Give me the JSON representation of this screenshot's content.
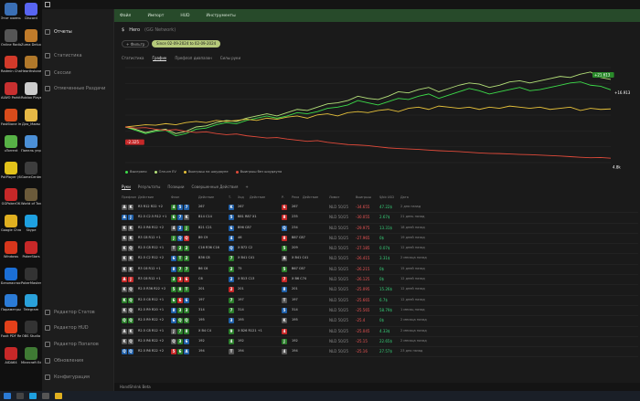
{
  "desktop_icons": [
    {
      "label": "Этот компьютер",
      "color": "#3a6fb5"
    },
    {
      "label": "Discord",
      "color": "#5865f2"
    },
    {
      "label": "Online Radio",
      "color": "#555"
    },
    {
      "label": "Zuma Deluxe",
      "color": "#c07b2a"
    },
    {
      "label": "Radmin Chat",
      "color": "#d23a2a"
    },
    {
      "label": "Hearthstone",
      "color": "#b0782a"
    },
    {
      "label": "ALWO Parkits",
      "color": "#c83030"
    },
    {
      "label": "Roblox Player",
      "color": "#cccccc"
    },
    {
      "label": "FastStone Image Viewer",
      "color": "#d84b1b"
    },
    {
      "label": "Для_Мамы",
      "color": "#e6b845"
    },
    {
      "label": "uTorrent",
      "color": "#57b246"
    },
    {
      "label": "Панель управления",
      "color": "#4b8fd6"
    },
    {
      "label": "PotPlayer (64-bit)",
      "color": "#e2c21a"
    },
    {
      "label": "GameCenter",
      "color": "#3d3d3d"
    },
    {
      "label": "GGPokerOK",
      "color": "#c62828"
    },
    {
      "label": "World of Tanks EU",
      "color": "#6b5a3a"
    },
    {
      "label": "Google Chrome",
      "color": "#e0b020"
    },
    {
      "label": "Skype",
      "color": "#1ea0e0"
    },
    {
      "label": "Windows",
      "color": "#d7361c"
    },
    {
      "label": "PokerStars",
      "color": "#c62828"
    },
    {
      "label": "Безопасность Windows",
      "color": "#1b6fd6"
    },
    {
      "label": "PokerMaster",
      "color": "#333"
    },
    {
      "label": "Параметры",
      "color": "#2b7bd6"
    },
    {
      "label": "Telegram",
      "color": "#2aa1da"
    },
    {
      "label": "Foxit PDF Reader",
      "color": "#e2401a"
    },
    {
      "label": "OBS Studio",
      "color": "#333"
    },
    {
      "label": "AIDA64",
      "color": "#c62828"
    },
    {
      "label": "Minecraft Education",
      "color": "#3f7a34"
    }
  ],
  "sidebar": {
    "items": [
      {
        "label": "Отчеты",
        "active": true
      },
      {
        "label": "Статистика",
        "active": false
      },
      {
        "label": "Сессии",
        "active": false
      },
      {
        "label": "Отмеченные Раздачи",
        "active": false
      }
    ],
    "bottom_items": [
      {
        "label": "Редактор Статов"
      },
      {
        "label": "Редактор HUD"
      },
      {
        "label": "Редактор Попапов"
      },
      {
        "label": "Обновления"
      },
      {
        "label": "Конфигурация"
      }
    ]
  },
  "menubar": {
    "items": [
      "Файл",
      "Импорт",
      "HUD",
      "Инструменты"
    ]
  },
  "header": {
    "title": "Hero",
    "subtitle": "(GG Network)"
  },
  "filter_button": "+ Фильтр",
  "date_range": "Since 02-09-2024 to 02-09-2024",
  "chart_tabs": [
    "Статистика",
    "График",
    "Префлоп диапазон",
    "Силы руки"
  ],
  "active_chart_tab": "График",
  "chart_data": {
    "type": "line",
    "x": [
      0,
      100,
      200,
      300,
      400,
      500,
      600,
      700,
      800,
      900,
      1000,
      1100,
      1200,
      1300,
      1400,
      1500,
      1600,
      1700,
      1800,
      1900,
      2000,
      2100,
      2200,
      2300,
      2400,
      2500,
      2600,
      2700,
      2800,
      2900,
      3000,
      3100,
      3200,
      3300,
      3400,
      3500,
      3600,
      3700,
      3800,
      3900,
      4000,
      4100,
      4200,
      4300,
      4400,
      4500,
      4600,
      4700,
      4800
    ],
    "series": [
      {
        "name": "Выиграно",
        "color": "#3ddc4a",
        "values": [
          0,
          -1.5,
          -3,
          -2,
          -1.5,
          -4,
          -3,
          -1,
          -0.5,
          1,
          2,
          1.5,
          3,
          4,
          5,
          4,
          5,
          6.5,
          6,
          7,
          8.5,
          9,
          10,
          12,
          11,
          10,
          11.5,
          13,
          12.5,
          14,
          15,
          13,
          14.5,
          16,
          17.5,
          16.5,
          15,
          16,
          17,
          18,
          16.5,
          17,
          18,
          19,
          20,
          20.5,
          19,
          18.5,
          16.913
        ]
      },
      {
        "name": "Олл-ин EV",
        "color": "#b5e27a",
        "values": [
          0,
          -1,
          -2.5,
          -1.5,
          -1,
          -3,
          -2,
          0,
          0.5,
          2,
          3,
          2.5,
          4,
          5,
          6,
          5,
          6.5,
          8,
          7.5,
          9,
          10.5,
          11,
          12,
          14,
          13,
          12.5,
          14,
          16,
          15.5,
          17,
          18,
          16,
          17.5,
          19,
          20,
          19.5,
          18,
          19,
          20.5,
          21,
          20,
          21,
          22,
          23,
          22.5,
          24,
          25,
          22.5,
          21.613
        ]
      },
      {
        "name": "Выигрыш на шоудауне",
        "color": "#e7c23a",
        "values": [
          0,
          0.5,
          1,
          0.8,
          1.5,
          1,
          2,
          2.5,
          2,
          3,
          2.5,
          3,
          3.5,
          3,
          4,
          3.5,
          4.5,
          5,
          4,
          5.5,
          6,
          5,
          6.5,
          7,
          6.5,
          7.5,
          8,
          7,
          8.5,
          9,
          8,
          9.5,
          9,
          8.5,
          9,
          8,
          9,
          8.5,
          9.5,
          9,
          8.5,
          9,
          8,
          8.5,
          9,
          7.5,
          8.5,
          8,
          8.2
        ]
      },
      {
        "name": "Выигрыш без шоудауна",
        "color": "#e04a3a",
        "values": [
          0,
          -0.5,
          -0.3,
          -1,
          -1.5,
          -1.2,
          -2,
          -2.5,
          -2.2,
          -3,
          -3.5,
          -3.2,
          -4,
          -4.5,
          -5,
          -4.8,
          -5.5,
          -6,
          -6.5,
          -6.2,
          -7,
          -7.5,
          -8,
          -8.2,
          -8.5,
          -9,
          -9.5,
          -9.8,
          -10,
          -10.2,
          -10.5,
          -10.8,
          -11,
          -11.2,
          -11.5,
          -11.8,
          -12,
          -12.1,
          -12.3,
          -12.5,
          -12.6,
          -12.8,
          -13,
          -13.2,
          -13.5,
          -13.8,
          -14,
          -13.9,
          -14.2
        ]
      }
    ],
    "labels": {
      "final_allin": "+21.613",
      "final_won": "+16.913",
      "min": "-2.325",
      "max_x": "4.8k"
    },
    "grid": true
  },
  "table_tabs": [
    "Руки",
    "Результаты",
    "Позиции",
    "Совершенные Действия",
    "+"
  ],
  "table_headers": [
    "Префлоп",
    "Действие",
    "Флоп",
    "Действие",
    "Т.",
    "Ход",
    "Действие",
    "Р.",
    "Река",
    "Действие",
    "Лимит",
    "Выигрыш",
    "$/bb USD",
    "Дата"
  ],
  "rows": [
    {
      "hand": [
        "A",
        "K"
      ],
      "hc": [
        "#555",
        "#555"
      ],
      "pre": "R3 R12 R22 +2",
      "flop": [
        "4",
        "5",
        "7"
      ],
      "fc": [
        "#2a7d2a",
        "#1f5fa8",
        "#1f5fa8"
      ],
      "fa": "267",
      "turn": "K",
      "tc": "#1f5fa8",
      "ta": "267",
      "river": "6",
      "rc": "#c62828",
      "ra": "267",
      "limit": "NLD 50/25",
      "won": "-34.655",
      "bb": "47.22$",
      "date": "2 дня назад"
    },
    {
      "hand": [
        "A",
        "J"
      ],
      "hc": [
        "#1f5fa8",
        "#1f5fa8"
      ],
      "pre": "R2.5 C2.5 R12 +1",
      "flop": [
        "6",
        "7",
        "K"
      ],
      "fc": [
        "#2a7d2a",
        "#1f5fa8",
        "#555"
      ],
      "fa": "B14 C14",
      "turn": "5",
      "tc": "#1f5fa8",
      "ta": "B81 R87 X1",
      "river": "8",
      "rc": "#c62828",
      "ra": "235",
      "limit": "NLD 50/25",
      "won": "-30.055",
      "bb": "2.67$",
      "date": "21 день назад"
    },
    {
      "hand": [
        "K",
        "K"
      ],
      "hc": [
        "#555",
        "#555"
      ],
      "pre": "R2.5 R6 R12 +2",
      "flop": [
        "4",
        "2",
        "J"
      ],
      "fc": [
        "#555",
        "#1f5fa8",
        "#2a7d2a"
      ],
      "fa": "B21 C21",
      "turn": "6",
      "tc": "#1f5fa8",
      "ta": "B96 C87",
      "river": "Q",
      "rc": "#1f5fa8",
      "ra": "234",
      "limit": "NLD 50/25",
      "won": "-29.975",
      "bb": "13.31$",
      "date": "18 дней назад"
    },
    {
      "hand": [
        "K",
        "K"
      ],
      "hc": [
        "#555",
        "#555"
      ],
      "pre": "R3 C8 R12 +1",
      "flop": [
        "J",
        "Q",
        "Q"
      ],
      "fc": [
        "#2a7d2a",
        "#1f5fa8",
        "#c62828"
      ],
      "fa": "B9 C9",
      "turn": "4",
      "tc": "#1f5fa8",
      "ta": "46",
      "river": "8",
      "rc": "#c62828",
      "ra": "B87 C87",
      "limit": "NLD 50/25",
      "won": "-27.965",
      "bb": "0$",
      "date": "19 дней назад"
    },
    {
      "hand": [
        "K",
        "Q"
      ],
      "hc": [
        "#555",
        "#555"
      ],
      "pre": "R2.5 C8 R12 +1",
      "flop": [
        "T",
        "2",
        "2"
      ],
      "fc": [
        "#555",
        "#2a7d2a",
        "#2a7d2a"
      ],
      "fa": "C16 R36 C16",
      "turn": "Q",
      "tc": "#1f5fa8",
      "ta": "X B72 C2",
      "river": "5",
      "rc": "#2a7d2a",
      "ra": "209",
      "limit": "NLD 50/25",
      "won": "-27.185",
      "bb": "0.07$",
      "date": "12 дней назад"
    },
    {
      "hand": [
        "K",
        "K"
      ],
      "hc": [
        "#555",
        "#555"
      ],
      "pre": "R2.5 C2 R12 +2",
      "flop": [
        "6",
        "T",
        "2"
      ],
      "fc": [
        "#1f5fa8",
        "#2a7d2a",
        "#2a7d2a"
      ],
      "fa": "B36 C8",
      "turn": "7",
      "tc": "#2a7d2a",
      "ta": "X B41 C41",
      "river": "A",
      "rc": "#555",
      "ra": "X B41 C41",
      "limit": "NLD 50/25",
      "won": "-26.415",
      "bb": "3.31$",
      "date": "2 месяца назад"
    },
    {
      "hand": [
        "K",
        "K"
      ],
      "hc": [
        "#555",
        "#555"
      ],
      "pre": "R3 C6 R12 +1",
      "flop": [
        "8",
        "7",
        "7"
      ],
      "fc": [
        "#1f5fa8",
        "#2a7d2a",
        "#2a7d2a"
      ],
      "fa": "B6 C6",
      "turn": "2",
      "tc": "#2a7d2a",
      "ta": "75",
      "river": "5",
      "rc": "#2a7d2a",
      "ra": "B67 C67",
      "limit": "NLD 50/25",
      "won": "-26.215",
      "bb": "0$",
      "date": "15 дней назад"
    },
    {
      "hand": [
        "A",
        "J"
      ],
      "hc": [
        "#c62828",
        "#c62828"
      ],
      "pre": "R3 C6 R12 +1",
      "flop": [
        "3",
        "3",
        "6"
      ],
      "fc": [
        "#2a7d2a",
        "#c62828",
        "#c62828"
      ],
      "fa": "C6",
      "turn": "2",
      "tc": "#1f5fa8",
      "ta": "X B13 C13",
      "river": "7",
      "rc": "#c62828",
      "ra": "X B6 C74",
      "limit": "NLD 50/25",
      "won": "-26.125",
      "bb": "0$",
      "date": "12 дней назад"
    },
    {
      "hand": [
        "K",
        "Q"
      ],
      "hc": [
        "#555",
        "#555"
      ],
      "pre": "R2.5 R36 R22 +2",
      "flop": [
        "5",
        "8",
        "T"
      ],
      "fc": [
        "#2a7d2a",
        "#2a7d2a",
        "#2a7d2a"
      ],
      "fa": "201",
      "turn": "2",
      "tc": "#c62828",
      "ta": "201",
      "river": "8",
      "rc": "#1f5fa8",
      "ra": "201",
      "limit": "NLD 50/25",
      "won": "-25.095",
      "bb": "15.26$",
      "date": "12 дней назад"
    },
    {
      "hand": [
        "K",
        "Q"
      ],
      "hc": [
        "#2a7d2a",
        "#2a7d2a"
      ],
      "pre": "R2.5 C6 R12 +1",
      "flop": [
        "6",
        "6",
        "6"
      ],
      "fc": [
        "#2a7d2a",
        "#c62828",
        "#1f5fa8"
      ],
      "fa": "197",
      "turn": "7",
      "tc": "#2a7d2a",
      "ta": "197",
      "river": "T",
      "rc": "#555",
      "ra": "197",
      "limit": "NLD 50/25",
      "won": "-25.665",
      "bb": "6.7$",
      "date": "12 дней назад"
    },
    {
      "hand": [
        "K",
        "Q"
      ],
      "hc": [
        "#555",
        "#555"
      ],
      "pre": "R2.5 R9 R20 +1",
      "flop": [
        "8",
        "3",
        "3"
      ],
      "fc": [
        "#1f5fa8",
        "#2a7d2a",
        "#2a7d2a"
      ],
      "fa": "314",
      "turn": "7",
      "tc": "#2a7d2a",
      "ta": "314",
      "river": "5",
      "rc": "#1f5fa8",
      "ra": "314",
      "limit": "NLD 50/25",
      "won": "-25.565",
      "bb": "58.79$",
      "date": "1 месяц назад"
    },
    {
      "hand": [
        "Q",
        "Q"
      ],
      "hc": [
        "#2a7d2a",
        "#2a7d2a"
      ],
      "pre": "R2.5 R9 R22 +2",
      "flop": [
        "6",
        "Q",
        "Q"
      ],
      "fc": [
        "#1f5fa8",
        "#2a7d2a",
        "#2a7d2a"
      ],
      "fa": "195",
      "turn": "3",
      "tc": "#1f5fa8",
      "ta": "195",
      "river": "K",
      "rc": "#555",
      "ra": "195",
      "limit": "NLD 50/25",
      "won": "-25.4",
      "bb": "0$",
      "date": "2 месяца назад"
    },
    {
      "hand": [
        "A",
        "K"
      ],
      "hc": [
        "#555",
        "#555"
      ],
      "pre": "R2.5 C8 R12 +1",
      "flop": [
        "J",
        "7",
        "8"
      ],
      "fc": [
        "#555",
        "#2a7d2a",
        "#2a7d2a"
      ],
      "fa": "X B4 C4",
      "turn": "9",
      "tc": "#2a7d2a",
      "ta": "X B26 R121 +1",
      "river": "4",
      "rc": "#c62828",
      "ra": "",
      "limit": "NLD 50/25",
      "won": "-25.045",
      "bb": "4.33$",
      "date": "2 месяца назад"
    },
    {
      "hand": [
        "K",
        "Q"
      ],
      "hc": [
        "#555",
        "#555"
      ],
      "pre": "R2.5 R6 R22 +2",
      "flop": [
        "Q",
        "3",
        "6"
      ],
      "fc": [
        "#555",
        "#2a7d2a",
        "#1f5fa8"
      ],
      "fa": "192",
      "turn": "4",
      "tc": "#2a7d2a",
      "ta": "192",
      "river": "J",
      "rc": "#2a7d2a",
      "ra": "192",
      "limit": "NLD 50/25",
      "won": "-25.15",
      "bb": "22.65$",
      "date": "2 месяца назад"
    },
    {
      "hand": [
        "Q",
        "Q"
      ],
      "hc": [
        "#1f5fa8",
        "#1f5fa8"
      ],
      "pre": "R2.5 R6 R22 +2",
      "flop": [
        "5",
        "6",
        "A"
      ],
      "fc": [
        "#c62828",
        "#2a7d2a",
        "#1f5fa8"
      ],
      "fa": "194",
      "turn": "T",
      "tc": "#555",
      "ta": "194",
      "river": "4",
      "rc": "#555",
      "ra": "194",
      "limit": "NLD 50/25",
      "won": "-25.16",
      "bb": "27.57$",
      "date": "23 дня назад"
    }
  ],
  "statusbar": "HandShrink Beta"
}
